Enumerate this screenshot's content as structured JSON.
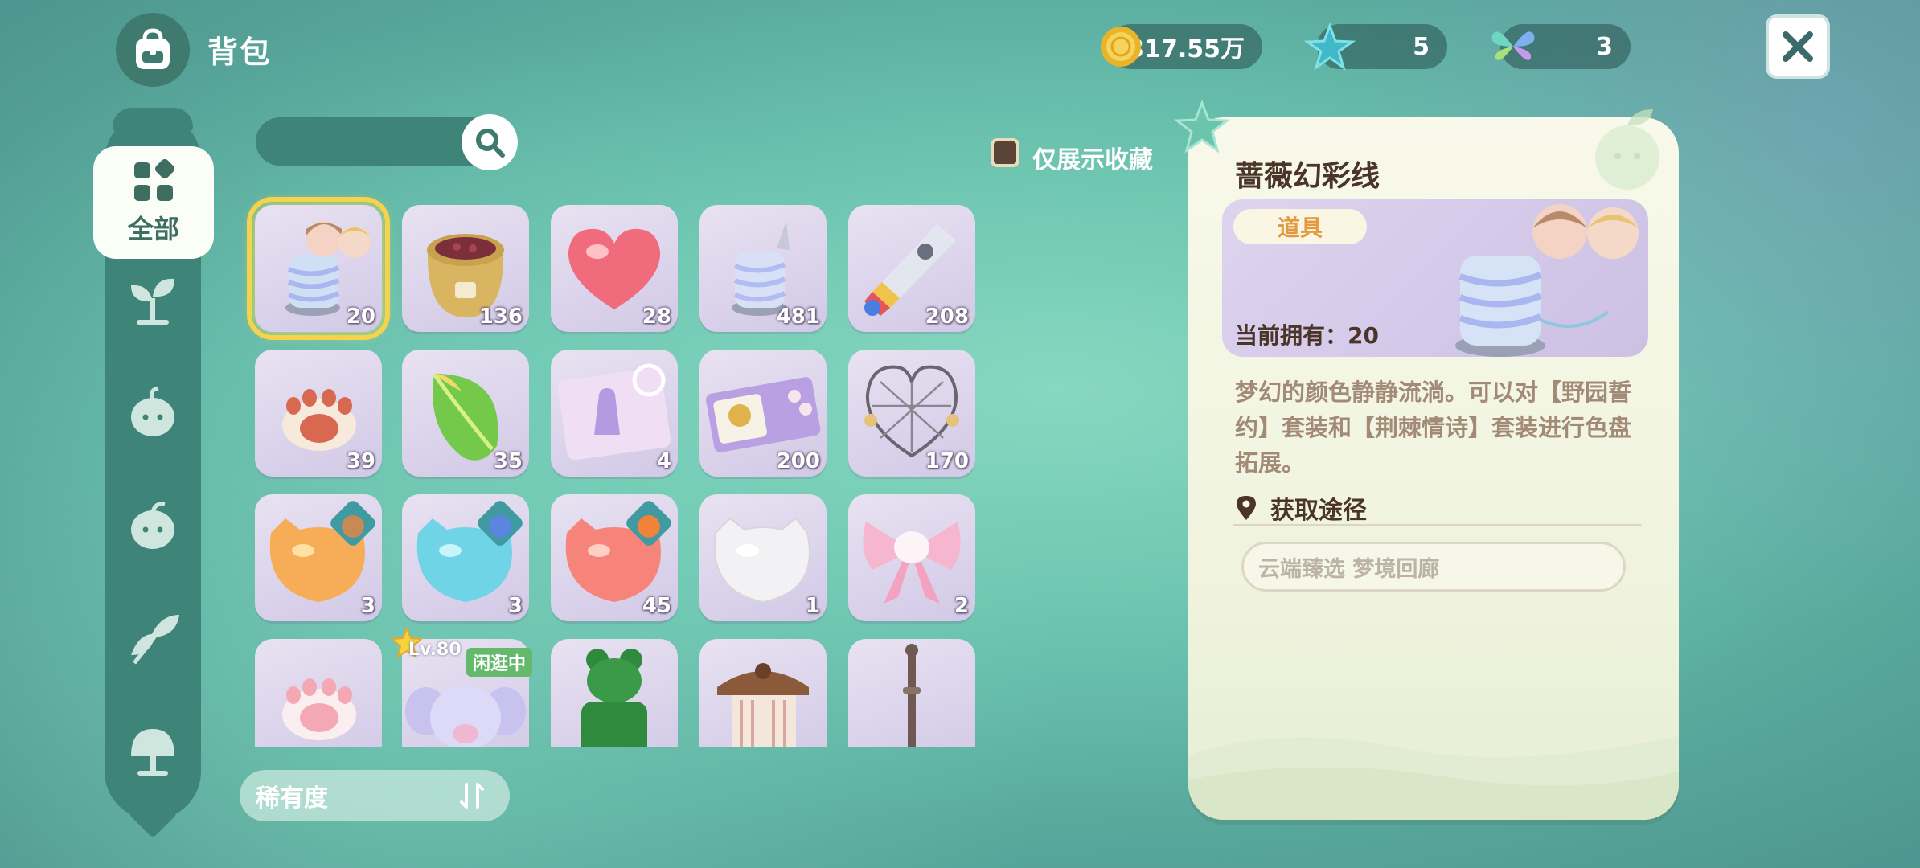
{
  "header": {
    "title": "背包",
    "bag_icon": "backpack-icon",
    "currencies": [
      {
        "name": "coin",
        "icon": "gold-coin-icon",
        "value": "317.55万"
      },
      {
        "name": "star",
        "icon": "star-gem-icon",
        "value": "5"
      },
      {
        "name": "butterfly",
        "icon": "butterfly-icon",
        "value": "3"
      }
    ],
    "close_icon": "close-icon"
  },
  "sidebar": {
    "items": [
      {
        "label": "全部",
        "icon": "grid-icon",
        "active": true
      },
      {
        "label": "",
        "icon": "sprout-icon"
      },
      {
        "label": "",
        "icon": "round-plant-icon"
      },
      {
        "label": "",
        "icon": "fruit-icon"
      },
      {
        "label": "",
        "icon": "leaf-bud-icon"
      },
      {
        "label": "",
        "icon": "tree-icon"
      }
    ]
  },
  "search": {
    "placeholder": "",
    "icon": "search-icon"
  },
  "filter": {
    "favorites_only_label": "仅展示收藏",
    "checked": false
  },
  "grid": {
    "items": [
      {
        "name": "蔷薇幻彩线",
        "icon": "thread-spool-icon",
        "count": "20",
        "selected": true
      },
      {
        "name": "seed-sack",
        "icon": "sack-icon",
        "count": "136"
      },
      {
        "name": "heart-jelly",
        "icon": "heart-icon",
        "count": "28"
      },
      {
        "name": "thread-spool-2",
        "icon": "thread-spool-icon",
        "count": "481"
      },
      {
        "name": "paint-tube",
        "icon": "paint-tube-icon",
        "count": "208"
      },
      {
        "name": "paw-stamp",
        "icon": "paw-icon",
        "count": "39"
      },
      {
        "name": "green-leaf",
        "icon": "leaf-icon",
        "count": "35"
      },
      {
        "name": "outfit-ticket",
        "icon": "ticket-icon",
        "count": "4"
      },
      {
        "name": "gift-coupon",
        "icon": "coupon-icon",
        "count": "200"
      },
      {
        "name": "heart-cage",
        "icon": "wire-heart-icon",
        "count": "170"
      },
      {
        "name": "orange-cat-jelly",
        "icon": "cat-jelly-icon",
        "count": "3"
      },
      {
        "name": "blue-cat-jelly",
        "icon": "cat-jelly-icon",
        "count": "3"
      },
      {
        "name": "red-cat-jelly",
        "icon": "cat-jelly-icon",
        "count": "45"
      },
      {
        "name": "white-cat-jelly",
        "icon": "cat-jelly-icon",
        "count": "1"
      },
      {
        "name": "pink-bow",
        "icon": "bow-icon",
        "count": "2"
      },
      {
        "name": "pink-paw",
        "icon": "paw-icon",
        "count": ""
      },
      {
        "name": "elephant-pet",
        "icon": "elephant-icon",
        "count": "",
        "level": "Lv.80",
        "status": "闲逛中"
      },
      {
        "name": "topiary",
        "icon": "topiary-icon",
        "count": ""
      },
      {
        "name": "towel-rack",
        "icon": "towel-rack-icon",
        "count": ""
      },
      {
        "name": "lamp-post",
        "icon": "lamp-icon",
        "count": ""
      }
    ]
  },
  "sort": {
    "label": "稀有度",
    "icon": "sort-icon"
  },
  "detail": {
    "name": "蔷薇幻彩线",
    "type": "道具",
    "owned": "当前拥有：20",
    "description": "梦幻的颜色静静流淌。可以对【野园誓约】套装和【荆棘情诗】套装进行色盘拓展。",
    "source_title": "获取途径",
    "source_icon": "location-pin-icon",
    "sources": [
      "云端臻选 梦境回廊"
    ]
  },
  "colors": {
    "accent_gold": "#f5d34a",
    "teal_dark": "#3f8478",
    "panel_bg": "#f8f9ea",
    "item_bg": "#d2c9e6",
    "type_text": "#e29a3f"
  }
}
